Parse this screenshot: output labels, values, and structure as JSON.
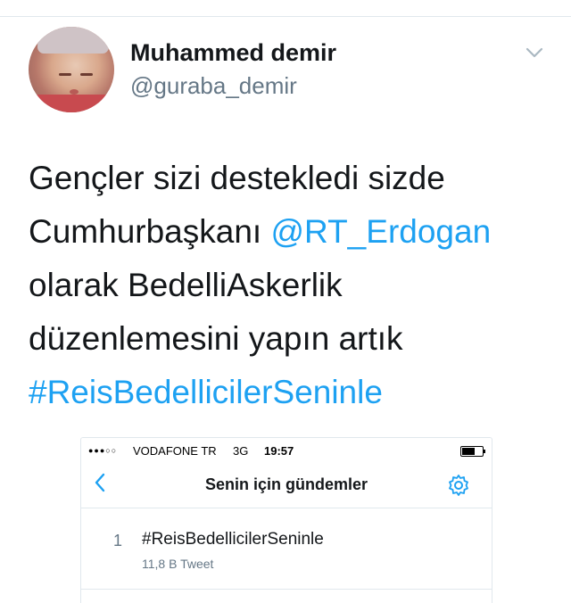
{
  "user": {
    "display_name": "Muhammed demir",
    "handle": "@guraba_demir"
  },
  "tweet": {
    "line1": "Gençler sizi destekledi sizde",
    "line2_prefix": "Cumhurbaşkanı ",
    "mention": "@RT_Erdogan",
    "line3": "olarak BedelliAskerlik",
    "line4": "düzenlemesini yapın artık",
    "hashtag": "#ReisBedellicilerSeninle"
  },
  "screenshot": {
    "status": {
      "signal": "●●●○○",
      "carrier": "VODAFONE TR",
      "network": "3G",
      "time": "19:57"
    },
    "title": "Senin için gündemler",
    "trends": [
      {
        "rank": "1",
        "tag": "#ReisBedellicilerSeninle",
        "count": "11,8 B Tweet"
      }
    ]
  },
  "colors": {
    "link": "#1da1f2",
    "muted": "#657786"
  },
  "icons": [
    "chevron-down-icon",
    "back-chevron-icon",
    "gear-icon",
    "battery-icon",
    "signal-icon"
  ]
}
